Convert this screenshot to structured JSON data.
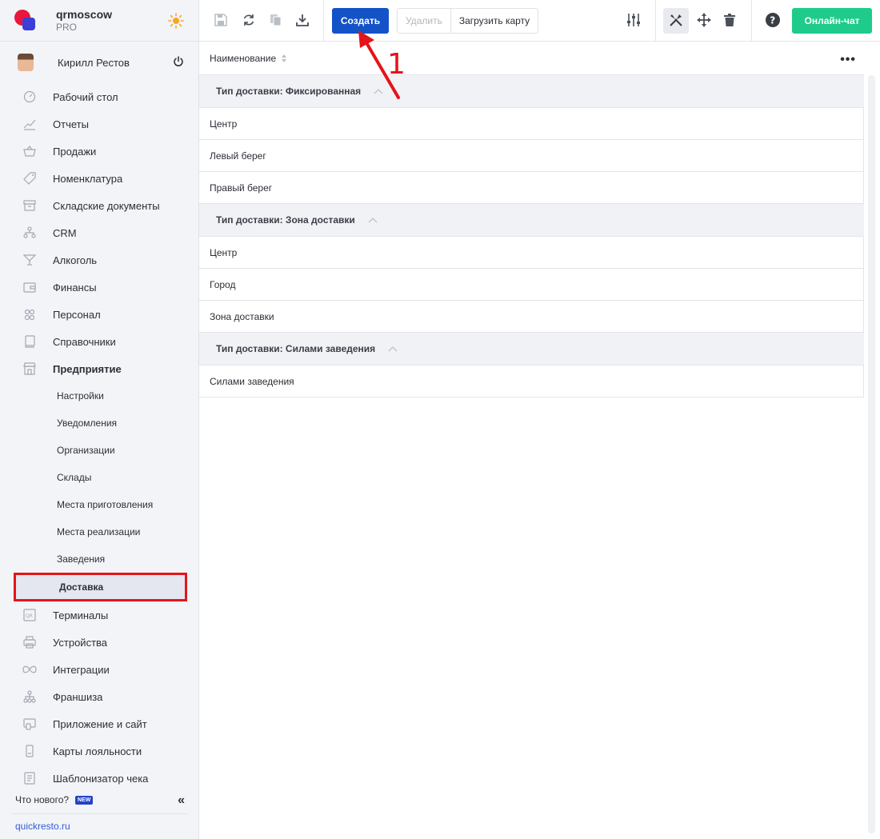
{
  "brand": {
    "name": "qrmoscow",
    "plan": "PRO"
  },
  "user": {
    "name": "Кирилл Рестов"
  },
  "sidebar": {
    "items": [
      {
        "label": "Рабочий стол",
        "icon": "dashboard-icon"
      },
      {
        "label": "Отчеты",
        "icon": "chart-icon"
      },
      {
        "label": "Продажи",
        "icon": "basket-icon"
      },
      {
        "label": "Номенклатура",
        "icon": "tag-icon"
      },
      {
        "label": "Складские документы",
        "icon": "archive-icon"
      },
      {
        "label": "CRM",
        "icon": "people-tree-icon"
      },
      {
        "label": "Алкоголь",
        "icon": "cocktail-icon"
      },
      {
        "label": "Финансы",
        "icon": "wallet-icon"
      },
      {
        "label": "Персонал",
        "icon": "staff-icon"
      },
      {
        "label": "Справочники",
        "icon": "book-icon"
      },
      {
        "label": "Предприятие",
        "icon": "store-icon"
      }
    ],
    "subitems": [
      {
        "label": "Настройки"
      },
      {
        "label": "Уведомления"
      },
      {
        "label": "Организации"
      },
      {
        "label": "Склады"
      },
      {
        "label": "Места приготовления"
      },
      {
        "label": "Места реализации"
      },
      {
        "label": "Заведения"
      },
      {
        "label": "Доставка"
      }
    ],
    "items_after": [
      {
        "label": "Терминалы",
        "icon": "qr-icon"
      },
      {
        "label": "Устройства",
        "icon": "printer-icon"
      },
      {
        "label": "Интеграции",
        "icon": "infinity-icon"
      },
      {
        "label": "Франшиза",
        "icon": "network-icon"
      },
      {
        "label": "Приложение и сайт",
        "icon": "app-icon"
      },
      {
        "label": "Карты лояльности",
        "icon": "card-icon"
      },
      {
        "label": "Шаблонизатор чека",
        "icon": "receipt-icon"
      }
    ],
    "whats_new": "Что нового?",
    "new_badge": "NEW",
    "site_link": "quickresto.ru"
  },
  "toolbar": {
    "create_label": "Создать",
    "delete_label": "Удалить",
    "upload_map_label": "Загрузить карту",
    "chat_label": "Онлайн-чат"
  },
  "table": {
    "column_header": "Наименование",
    "groups": [
      {
        "label": "Тип доставки: Фиксированная",
        "rows": [
          "Центр",
          "Левый берег",
          "Правый берег"
        ]
      },
      {
        "label": "Тип доставки: Зона доставки",
        "rows": [
          "Центр",
          "Город",
          "Зона доставки"
        ]
      },
      {
        "label": "Тип доставки: Силами заведения",
        "rows": [
          "Силами заведения"
        ]
      }
    ]
  },
  "annotation": {
    "number": "1"
  },
  "colors": {
    "accent": "#1452c8",
    "chat": "#1ecb8a",
    "highlight": "#e4141a"
  }
}
